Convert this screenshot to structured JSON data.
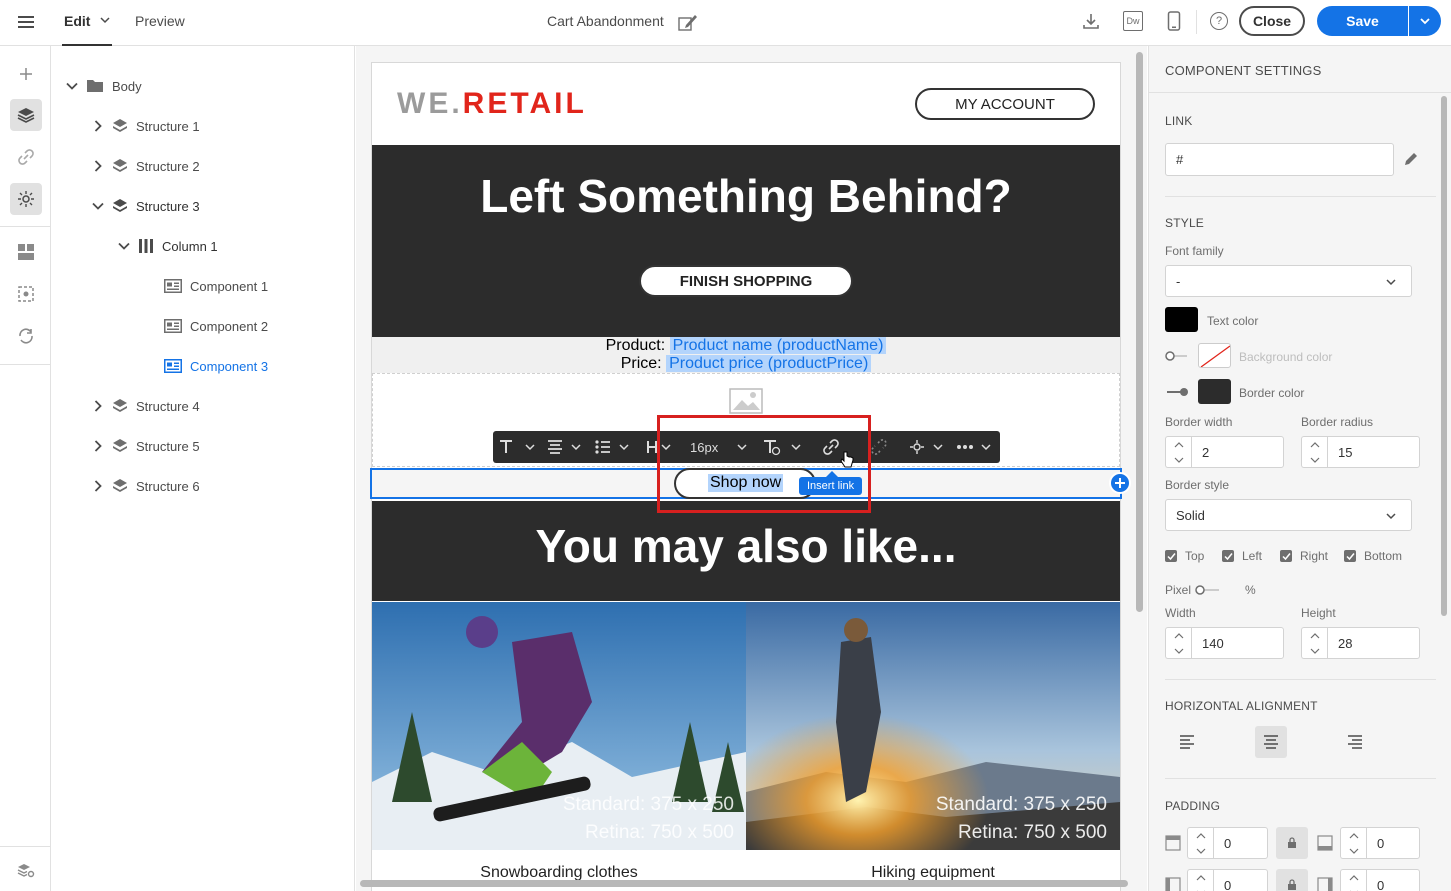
{
  "topbar": {
    "edit_label": "Edit",
    "preview_label": "Preview",
    "doc_title": "Cart Abandonment",
    "dw_label": "Dw",
    "close_label": "Close",
    "save_label": "Save"
  },
  "tree": {
    "body": "Body",
    "structure1": "Structure 1",
    "structure2": "Structure 2",
    "structure3": "Structure 3",
    "column1": "Column 1",
    "component1": "Component 1",
    "component2": "Component 2",
    "component3": "Component 3",
    "structure4": "Structure 4",
    "structure5": "Structure 5",
    "structure6": "Structure 6"
  },
  "email": {
    "logo_we": "WE.",
    "logo_retail": "RETAIL",
    "my_account": "MY ACCOUNT",
    "headline": "Left Something Behind?",
    "finish_shopping": "FINISH SHOPPING",
    "product_label": "Product:",
    "product_value": "Product name (productName)",
    "price_label": "Price:",
    "price_value": "Product price (productPrice)",
    "shop_now": "Shop now",
    "insert_link_tooltip": "Insert link",
    "font_size": "16px",
    "also_like": "You may also like...",
    "img1_line1": "Standard: 375 x 250",
    "img1_line2": "Retina: 750 x 500",
    "img2_line1": "Standard: 375 x 250",
    "img2_line2": "Retina: 750 x 500",
    "caption1": "Snowboarding clothes",
    "caption2": "Hiking equipment"
  },
  "settings": {
    "title": "COMPONENT SETTINGS",
    "link_section": "LINK",
    "link_value": "#",
    "style_section": "STYLE",
    "font_family_label": "Font family",
    "font_family_value": "-",
    "text_color_label": "Text color",
    "bg_color_label": "Background color",
    "border_color_label": "Border color",
    "border_width_label": "Border width",
    "border_width_value": "2",
    "border_radius_label": "Border radius",
    "border_radius_value": "15",
    "border_style_label": "Border style",
    "border_style_value": "Solid",
    "top_label": "Top",
    "left_label": "Left",
    "right_label": "Right",
    "bottom_label": "Bottom",
    "pixel_label": "Pixel",
    "percent_label": "%",
    "width_label": "Width",
    "width_value": "140",
    "height_label": "Height",
    "height_value": "28",
    "halign_section": "HORIZONTAL ALIGNMENT",
    "padding_section": "PADDING",
    "padding_top": "0",
    "padding_bottom": "0",
    "padding_left": "0",
    "padding_right": "0"
  },
  "colors": {
    "accent": "#1473e6",
    "logo_red": "#e1251b",
    "dark_band": "#2c2c2c",
    "highlight": "#b3d4fc",
    "callout": "#d7201f"
  }
}
